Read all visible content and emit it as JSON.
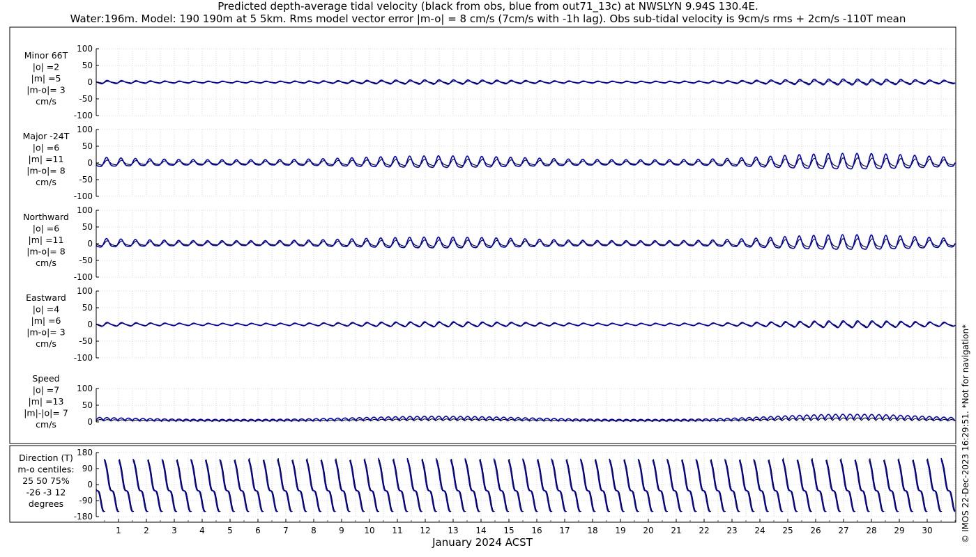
{
  "titles": {
    "line1": "Predicted depth-average tidal velocity (black from obs, blue from out71_13c) at NWSLYN 9.94S 130.4E.",
    "line2": "Water:196m. Model: 190 190m at 5 5km. Rms model vector error |m-o| = 8 cm/s (7cm/s with -1h lag). Obs sub-tidal velocity is 9cm/s rms + 2cm/s -110T mean"
  },
  "copyright": "© IMOS 22-Dec-2023 16:29:51. *Not for navigation*",
  "colors": {
    "obs": "#000000",
    "model": "#0000cc",
    "grid": "#bbbbbb"
  },
  "chart_data": {
    "type": "line",
    "xlabel": "January 2024 ACST",
    "x_ticks": [
      1,
      2,
      3,
      4,
      5,
      6,
      7,
      8,
      9,
      10,
      11,
      12,
      13,
      14,
      15,
      16,
      17,
      18,
      19,
      20,
      21,
      22,
      23,
      24,
      25,
      26,
      27,
      28,
      29,
      30
    ],
    "x_range_days": [
      0.2,
      31.0
    ],
    "grid": true,
    "series_names": [
      "obs",
      "model"
    ],
    "panels": [
      {
        "id": "minor",
        "label": [
          "Minor 66T",
          "|o| =2",
          "|m| =5",
          "|m-o|= 3",
          "cm/s"
        ],
        "yticks": [
          "100",
          "50",
          "0",
          "-50",
          "-100"
        ],
        "ylim": [
          -100,
          100
        ],
        "amp_obs": 3,
        "amp_model": 6,
        "phase_deg": 0
      },
      {
        "id": "major",
        "label": [
          "Major -24T",
          "|o| =6",
          "|m| =11",
          "|m-o|= 8",
          "cm/s"
        ],
        "yticks": [
          "100",
          "50",
          "0",
          "-50",
          "-100"
        ],
        "ylim": [
          -100,
          100
        ],
        "amp_obs": 9,
        "amp_model": 17,
        "phase_deg": 30
      },
      {
        "id": "northward",
        "label": [
          "Northward",
          "|o| =6",
          "|m| =11",
          "|m-o|= 8",
          "cm/s"
        ],
        "yticks": [
          "100",
          "50",
          "0",
          "-50",
          "-100"
        ],
        "ylim": [
          -100,
          100
        ],
        "amp_obs": 9,
        "amp_model": 16,
        "phase_deg": 30
      },
      {
        "id": "eastward",
        "label": [
          "Eastward",
          "|o| =4",
          "|m| =6",
          "|m-o|= 3",
          "cm/s"
        ],
        "yticks": [
          "100",
          "50",
          "0",
          "-50",
          "-100"
        ],
        "ylim": [
          -100,
          100
        ],
        "amp_obs": 5,
        "amp_model": 7,
        "phase_deg": 0
      },
      {
        "id": "speed",
        "label": [
          "Speed",
          "|o| =7",
          "|m| =13",
          "|m|-|o|= 7",
          "cm/s"
        ],
        "yticks": [
          "100",
          "50",
          "0"
        ],
        "ylim": [
          0,
          100
        ],
        "amp_obs": 9,
        "amp_model": 17,
        "phase_deg": 30
      },
      {
        "id": "direction",
        "label": [
          "Direction (T)",
          "m-o centiles:",
          "25  50  75%",
          "-26  -3  12",
          "degrees"
        ],
        "yticks": [
          "180",
          "90",
          "0",
          "-90",
          "-180"
        ],
        "ylim": [
          -180,
          180
        ],
        "centiles": [
          -26,
          -3,
          12
        ]
      }
    ]
  }
}
